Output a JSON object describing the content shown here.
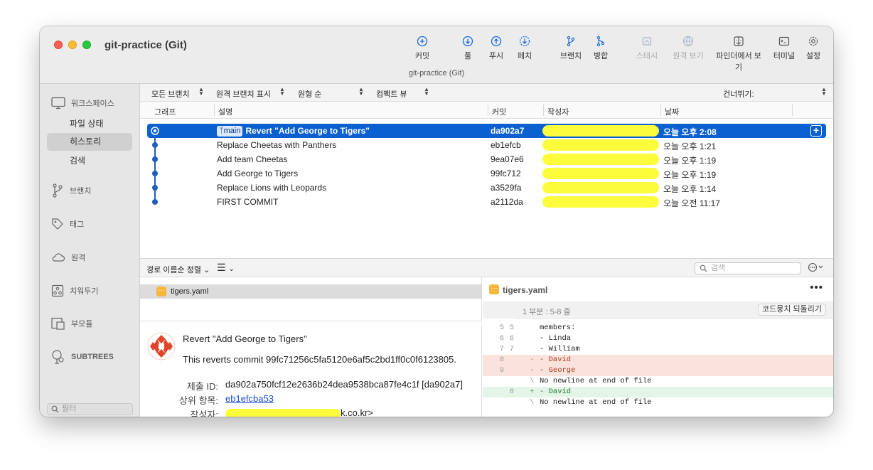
{
  "window": {
    "title": "git-practice (Git)",
    "subtitle": "git-practice (Git)"
  },
  "toolbar": {
    "commit": "커밋",
    "pull": "풀",
    "push": "푸시",
    "fetch": "페치",
    "branch": "브랜치",
    "merge": "병합",
    "stash": "스태시",
    "remote_view": "원격 보기",
    "finder": "파인더에서 보기",
    "terminal": "터미널",
    "settings": "설정"
  },
  "sidebar": {
    "workspace": "워크스페이스",
    "file_status": "파일 상태",
    "history": "히스토리",
    "search": "검색",
    "branches": "브랜치",
    "tags": "태그",
    "remotes": "원격",
    "stashes": "치워두기",
    "submodules": "부모듈",
    "subtrees": "SUBTREES",
    "filter_placeholder": "필터"
  },
  "filterbar": {
    "all_branches": "모든 브랜치",
    "show_remote": "원격 브랜치 표시",
    "order": "원형 순",
    "compact": "컴팩트 뷰",
    "jump": "건너뛰기:"
  },
  "columns": {
    "graph": "그래프",
    "description": "설명",
    "commit": "커밋",
    "author": "작성자",
    "date": "날짜"
  },
  "commits": [
    {
      "branch": "main",
      "description": "Revert \"Add George to Tigers\"",
      "hash": "da902a7",
      "date": "오늘 오후 2:08"
    },
    {
      "description": "Replace Cheetas with Panthers",
      "hash": "eb1efcb",
      "date": "오늘 오후 1:21"
    },
    {
      "description": "Add team Cheetas",
      "hash": "9ea07e6",
      "date": "오늘 오후 1:19"
    },
    {
      "description": "Add George to Tigers",
      "hash": "99fc712",
      "date": "오늘 오후 1:19"
    },
    {
      "description": "Replace Lions with Leopards",
      "hash": "a3529fa",
      "date": "오늘 오후 1:14"
    },
    {
      "description": "FIRST COMMIT",
      "hash": "a2112da",
      "date": "오늘 오전 11:17"
    }
  ],
  "lower": {
    "sort": "경로 이름순 정렬",
    "search_placeholder": "검색",
    "file": "tigers.yaml"
  },
  "commit_detail": {
    "title": "Revert \"Add George to Tigers\"",
    "body": "This reverts commit 99fc71256c5fa5120e6af5c2bd1ff0c0f6123805.",
    "id_label": "제출 ID:",
    "id_value": "da902a750fcf12e2636b24dea9538bca87fe4c1f [da902a7]",
    "parent_label": "상위 항목:",
    "parent_value": "eb1efcba53",
    "author_label": "작성자:",
    "author_suffix": "k.co.kr>"
  },
  "diff": {
    "file": "tigers.yaml",
    "hunk": "1 부분 : 5-8 줄",
    "revert_button": "코드뭉치 되돌리기",
    "lines": [
      {
        "type": "ctx",
        "old": "5",
        "new": "5",
        "mark": "",
        "code": "members:"
      },
      {
        "type": "ctx",
        "old": "6",
        "new": "6",
        "mark": "",
        "code": "- Linda"
      },
      {
        "type": "ctx",
        "old": "7",
        "new": "7",
        "mark": "",
        "code": "- William"
      },
      {
        "type": "del",
        "old": "8",
        "new": "",
        "mark": "-",
        "code": "- David"
      },
      {
        "type": "del",
        "old": "9",
        "new": "",
        "mark": "-",
        "code": "- George"
      },
      {
        "type": "ctx",
        "old": "",
        "new": "",
        "mark": "\\",
        "code": "No newline at end of file"
      },
      {
        "type": "add",
        "old": "",
        "new": "8",
        "mark": "+",
        "code": "- David"
      },
      {
        "type": "ctx",
        "old": "",
        "new": "",
        "mark": "\\",
        "code": "No newline at end of file"
      }
    ]
  }
}
